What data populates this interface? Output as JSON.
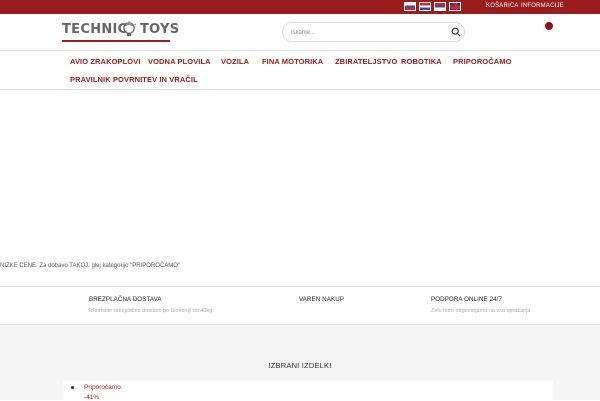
{
  "topbar": {
    "flags": [
      "slovenian-flag",
      "croatian-flag",
      "serbian-flag",
      "uk-flag"
    ],
    "cart_label": "KOŠARICA",
    "info_label": "INFORMACIJE",
    "color": "#9b1c1c"
  },
  "header": {
    "logo_left": "TECHNIC",
    "logo_right": "TOYS",
    "search_placeholder": "Iskanje..."
  },
  "menu": {
    "items": [
      "AVIO ZRAKOPLOVI",
      "VODNA PLOVILA",
      "VOZILA",
      "FINA MOTORIKA",
      "ZBIRATELJSTVO",
      "ROBOTIKA",
      "PRIPOROČAMO",
      "PRAVILNIK POVRNITEV IN VRAČIL"
    ]
  },
  "notice": {
    "text": "NIZKE CENE. Za dobavo TAKOJ, glej kategorijo \"PRIPOROČAMO\""
  },
  "features": [
    {
      "title": "BREZPLAČNA DOSTAVA",
      "subtitle": "Izkoristite brezplačno dostavo po Sloveniji do 40kg"
    },
    {
      "title": "VAREN NAKUP",
      "subtitle": ""
    },
    {
      "title": "PODPORA ONLINE 24/7",
      "subtitle": "Zelo hitro odgovarjamo na vsa vprašanja"
    }
  ],
  "products": {
    "title": "IZBRANI IZDELKI",
    "category": "Priporočamo",
    "badge": "-41%"
  },
  "colors": {
    "accent": "#981b1b",
    "background": "#ffffff",
    "section_bg": "#f5f5f5"
  }
}
